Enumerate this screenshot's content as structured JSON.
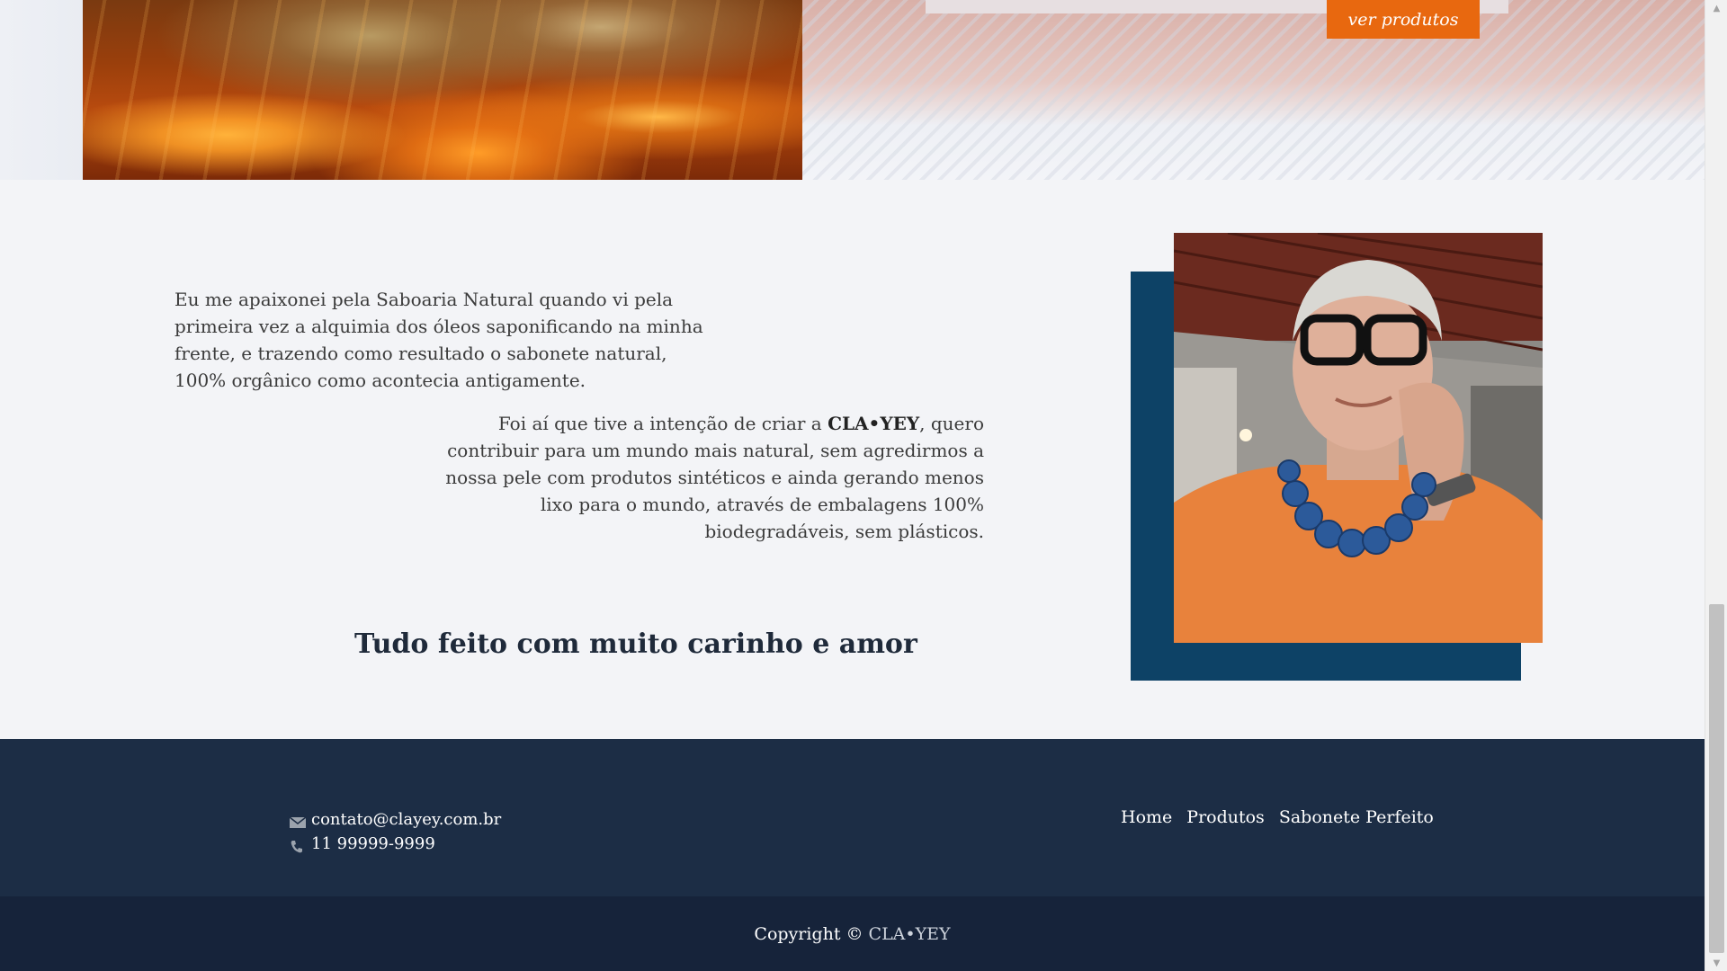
{
  "hero": {
    "cta_label": "ver produtos"
  },
  "about": {
    "paragraph1": "Eu me apaixonei pela Saboaria Natural quando vi pela primeira vez a alquimia dos óleos saponificando na minha frente, e trazendo como resultado o sabonete natural, 100% orgânico como acontecia antigamente.",
    "paragraph2_before": "Foi aí que tive a intenção de criar a ",
    "paragraph2_brand": "CLA•YEY",
    "paragraph2_after": ", quero contribuir para um mundo mais natural, sem agredirmos a nossa pele com produtos sintéticos e ainda gerando menos lixo para o mundo, através de embalagens 100% biodegradáveis, sem plásticos.",
    "tagline": "Tudo feito com muito carinho e amor"
  },
  "footer": {
    "email": "contato@clayey.com.br",
    "phone": "11 99999-9999",
    "nav": [
      {
        "label": "Home"
      },
      {
        "label": "Produtos"
      },
      {
        "label": "Sabonete Perfeito"
      }
    ],
    "copyright_prefix": "Copyright ©",
    "copyright_brand": "CLA•YEY"
  },
  "icons": {
    "email": "envelope-icon",
    "phone": "phone-icon",
    "scroll_up": "chevron-up-icon",
    "scroll_down": "chevron-down-icon"
  },
  "colors": {
    "accent": "#e8680f",
    "photo_frame": "#0d4266",
    "footer": "#1c2d45",
    "copyright_bar": "#16233a"
  }
}
